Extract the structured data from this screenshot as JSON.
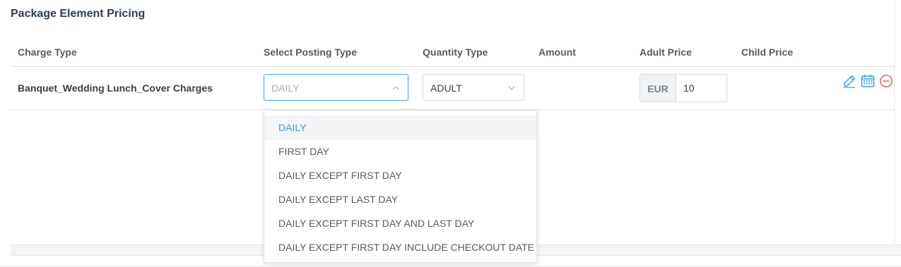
{
  "section": {
    "title": "Package Element Pricing"
  },
  "table": {
    "headers": {
      "charge_type": "Charge Type",
      "posting_type": "Select Posting Type",
      "quantity_type": "Quantity Type",
      "amount": "Amount",
      "adult_price": "Adult Price",
      "child_price": "Child Price"
    },
    "row": {
      "charge_type": "Banquet_Wedding Lunch_Cover Charges",
      "posting_type_placeholder": "DAILY",
      "quantity_type": "ADULT",
      "currency": "EUR",
      "adult_price": "10",
      "actions": [
        "pencil-icon",
        "calendar-icon",
        "minus-circle-icon"
      ]
    }
  },
  "posting_dropdown": {
    "selected": "DAILY",
    "options": [
      "DAILY",
      "FIRST DAY",
      "DAILY EXCEPT FIRST DAY",
      "DAILY EXCEPT LAST DAY",
      "DAILY EXCEPT FIRST DAY AND LAST DAY",
      "DAILY EXCEPT FIRST DAY INCLUDE CHECKOUT DATE"
    ]
  },
  "colors": {
    "accent": "#3a9de0",
    "remove": "#e25858",
    "heading": "#2c3e50"
  }
}
